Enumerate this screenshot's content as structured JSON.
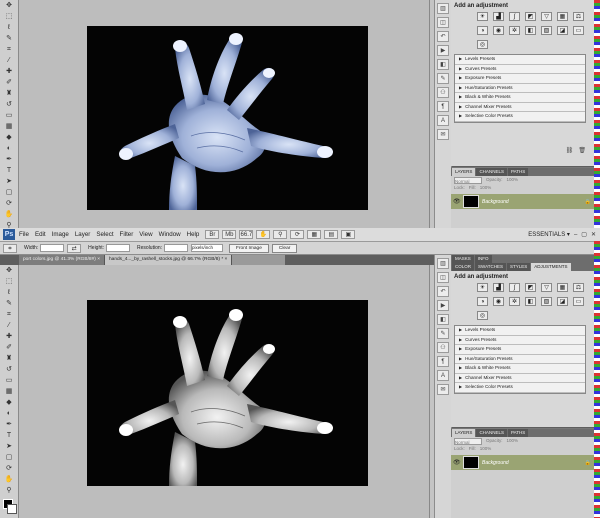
{
  "menubar": {
    "logo": "Ps",
    "items": [
      "File",
      "Edit",
      "Image",
      "Layer",
      "Select",
      "Filter",
      "View",
      "Window",
      "Help"
    ],
    "zoom": "66.7",
    "workspace": "ESSENTIALS ▾",
    "win_controls": [
      "–",
      "▢",
      "✕"
    ]
  },
  "options": {
    "width_label": "Width:",
    "height_label": "Height:",
    "resolution_label": "Resolution:",
    "resolution_unit": "pixels/inch",
    "front_image": "Front Image",
    "clear": "Clear"
  },
  "doc_tabs": [
    "port colors.jpg @ 41.3% (RGB/8#) ×",
    "hands_4..._by_rashell_stocks.jpg @ 66.7% (RGB/8) * ×"
  ],
  "panel": {
    "tabs": [
      "MASKS",
      "INFO",
      "COLOR",
      "SWATCHES",
      "STYLES",
      "ADJUSTMENTS"
    ],
    "title": "Add an adjustment",
    "presets": [
      "Levels Presets",
      "Curves Presets",
      "Exposure Presets",
      "Hue/Saturation Presets",
      "Black & White Presets",
      "Channel Mixer Presets",
      "Selective Color Presets"
    ]
  },
  "layers": {
    "tabs": [
      "LAYERS",
      "CHANNELS",
      "PATHS"
    ],
    "blend_mode": "Normal",
    "opacity_label": "Opacity:",
    "opacity": "100%",
    "lock_label": "Lock:",
    "fill_label": "Fill:",
    "fill": "100%",
    "layer_name": "Background"
  }
}
